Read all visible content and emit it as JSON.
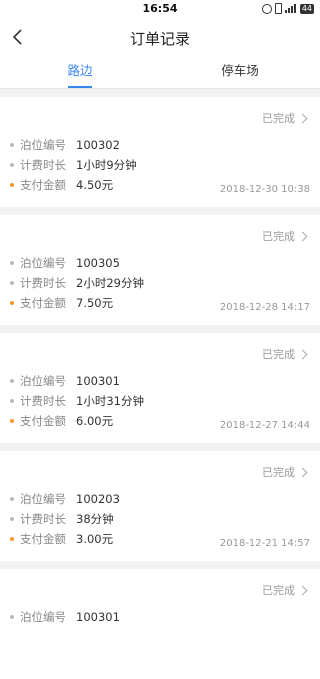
{
  "status_bar": {
    "time": "16:54",
    "battery": "44"
  },
  "nav": {
    "title": "订单记录"
  },
  "tabs": [
    {
      "label": "路边",
      "active": true
    },
    {
      "label": "停车场",
      "active": false
    }
  ],
  "orders": [
    {
      "status": "已完成",
      "spot_label": "泊位编号",
      "spot": "100302",
      "duration_label": "计费时长",
      "duration": "1小时9分钟",
      "amount_label": "支付金额",
      "amount": "4.50元",
      "date": "2018-12-30 10:38"
    },
    {
      "status": "已完成",
      "spot_label": "泊位编号",
      "spot": "100305",
      "duration_label": "计费时长",
      "duration": "2小时29分钟",
      "amount_label": "支付金额",
      "amount": "7.50元",
      "date": "2018-12-28 14:17"
    },
    {
      "status": "已完成",
      "spot_label": "泊位编号",
      "spot": "100301",
      "duration_label": "计费时长",
      "duration": "1小时31分钟",
      "amount_label": "支付金额",
      "amount": "6.00元",
      "date": "2018-12-27 14:44"
    },
    {
      "status": "已完成",
      "spot_label": "泊位编号",
      "spot": "100203",
      "duration_label": "计费时长",
      "duration": "38分钟",
      "amount_label": "支付金额",
      "amount": "3.00元",
      "date": "2018-12-21 14:57"
    },
    {
      "status": "已完成",
      "spot_label": "泊位编号",
      "spot": "100301"
    }
  ],
  "colors": {
    "accent": "#3a86ef",
    "amount_dot": "#f39a2b"
  }
}
